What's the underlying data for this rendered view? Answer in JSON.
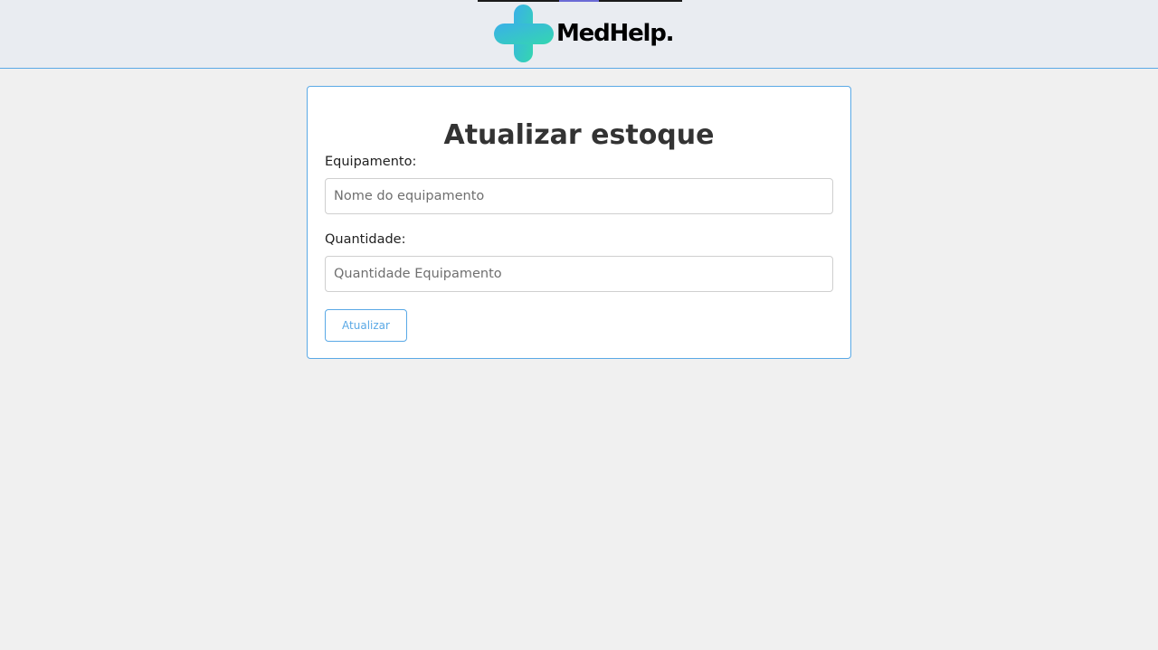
{
  "header": {
    "logo_text": "MedHelp.",
    "logo_icon": "medical-cross-icon",
    "colors": {
      "background": "#e9ecf1",
      "border": "#5aa9e6",
      "cross_gradient_start": "#3ab0e8",
      "cross_gradient_end": "#34d6b0"
    }
  },
  "form": {
    "title": "Atualizar estoque",
    "equipment": {
      "label": "Equipamento:",
      "placeholder": "Nome do equipamento",
      "value": ""
    },
    "quantity": {
      "label": "Quantidade:",
      "placeholder": "Quantidade Equipamento",
      "value": ""
    },
    "submit_label": "Atualizar",
    "accent_color": "#5aa9e6"
  }
}
